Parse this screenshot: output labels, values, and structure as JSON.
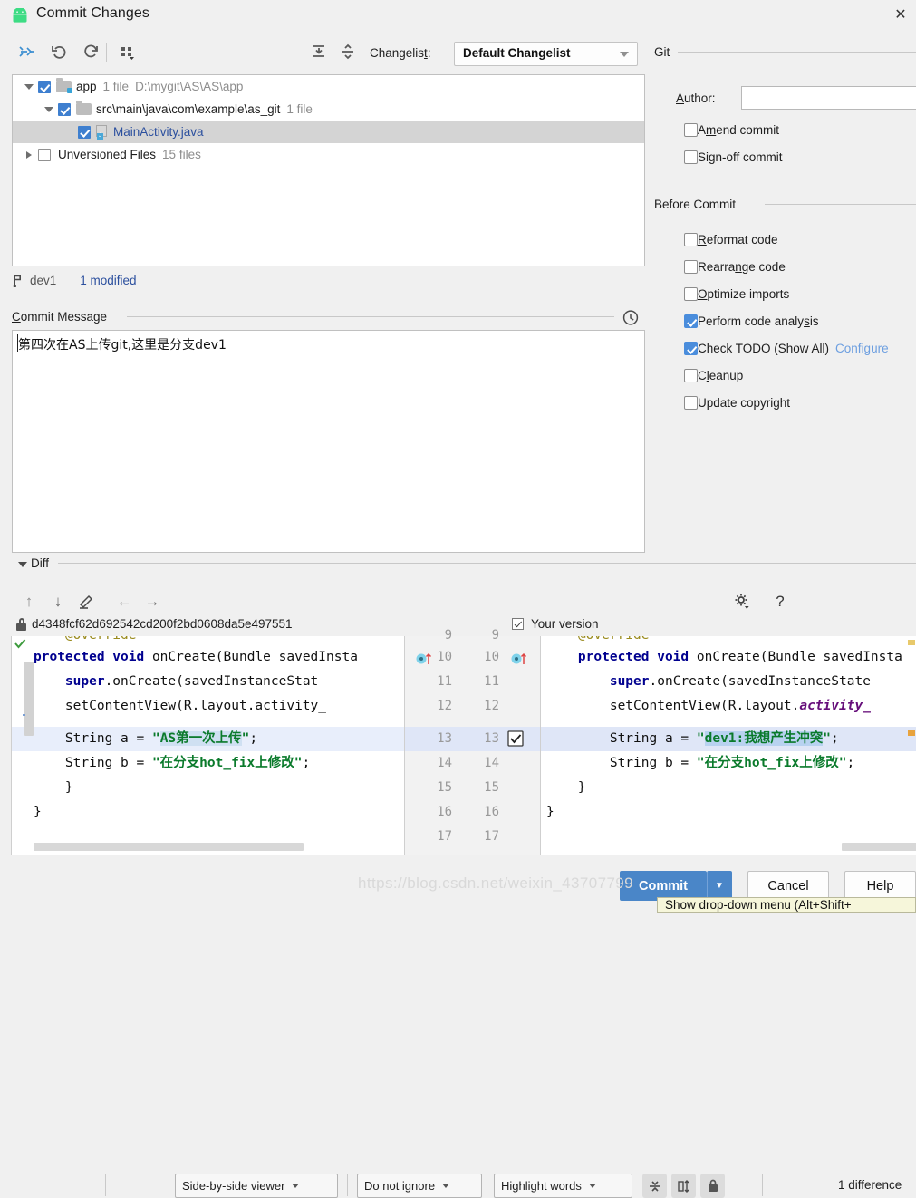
{
  "window": {
    "title": "Commit Changes",
    "icon": "android-robot-icon",
    "close_label": "✕"
  },
  "toolbar": {
    "buttons": [
      {
        "name": "collapse-arrows-icon",
        "glyph": "collapse"
      },
      {
        "name": "revert-icon",
        "glyph": "undo"
      },
      {
        "name": "refresh-icon",
        "glyph": "refresh"
      },
      {
        "name": "group-by-icon",
        "glyph": "group"
      },
      {
        "name": "expand-all-icon",
        "glyph": "expand-all"
      },
      {
        "name": "collapse-all-icon",
        "glyph": "collapse-all"
      }
    ],
    "changelist_label": "Changelist:",
    "changelist_value": "Default Changelist"
  },
  "tree": {
    "rows": [
      {
        "indent": 0,
        "twisty": "open",
        "checked": true,
        "icon": "folder-module-icon",
        "name": "app",
        "meta": "1 file",
        "meta2": "D:\\mygit\\AS\\AS\\app",
        "selected": false,
        "link": false
      },
      {
        "indent": 1,
        "twisty": "open",
        "checked": true,
        "icon": "folder-icon",
        "name": "src\\main\\java\\com\\example\\as_git",
        "meta": "1 file",
        "meta2": "",
        "selected": false,
        "link": false
      },
      {
        "indent": 2,
        "twisty": "none",
        "checked": true,
        "icon": "java-file-icon",
        "name": "MainActivity.java",
        "meta": "",
        "meta2": "",
        "selected": true,
        "link": true
      },
      {
        "indent": 0,
        "twisty": "closed",
        "checked": false,
        "icon": "none",
        "name": "Unversioned Files",
        "meta": "15 files",
        "meta2": "",
        "selected": false,
        "link": false
      }
    ]
  },
  "status": {
    "branch_icon": "git-branch-icon",
    "branch": "dev1",
    "modified": "1 modified"
  },
  "commit_message": {
    "section_title": "Commit Message",
    "section_mnemonic": "C",
    "history_icon": "clock-history-icon",
    "value": "第四次在AS上传git,这里是分支dev1",
    "placeholder": ""
  },
  "git_panel": {
    "section_title": "Git",
    "author_label": "Author:",
    "author_mnemonic": "A",
    "author_value": "",
    "checkboxes": [
      {
        "label": "Amend commit",
        "mnemonic": "m",
        "checked": false,
        "name": "amend-commit-checkbox"
      },
      {
        "label": "Sign-off commit",
        "mnemonic": "g",
        "checked": false,
        "name": "sign-off-commit-checkbox"
      }
    ]
  },
  "before_commit": {
    "section_title": "Before Commit",
    "checkboxes": [
      {
        "label": "Reformat code",
        "mnemonic": "R",
        "checked": false,
        "name": "reformat-code-checkbox",
        "link": ""
      },
      {
        "label": "Rearrange code",
        "mnemonic": "n",
        "checked": false,
        "name": "rearrange-code-checkbox",
        "link": ""
      },
      {
        "label": "Optimize imports",
        "mnemonic": "O",
        "checked": false,
        "name": "optimize-imports-checkbox",
        "link": ""
      },
      {
        "label": "Perform code analysis",
        "mnemonic": "s",
        "checked": true,
        "name": "perform-code-analysis-checkbox",
        "link": ""
      },
      {
        "label": "Check TODO (Show All)",
        "mnemonic": "",
        "checked": true,
        "name": "check-todo-checkbox",
        "link": "Configure"
      },
      {
        "label": "Cleanup",
        "mnemonic": "l",
        "checked": false,
        "name": "cleanup-checkbox",
        "link": ""
      },
      {
        "label": "Update copyright",
        "mnemonic": "",
        "checked": false,
        "name": "update-copyright-checkbox",
        "link": ""
      }
    ]
  },
  "diff": {
    "section_title": "Diff",
    "toolbar": {
      "prev_diff": "↑",
      "next_diff": "↓",
      "edit": "edit-pencil-icon",
      "left_arrow": "←",
      "right_arrow": "→",
      "viewer_mode": "Side-by-side viewer",
      "ignore_mode": "Do not ignore",
      "highlight_mode": "Highlight words",
      "collapse_unchanged": "collapse-unchanged-icon",
      "synchronize_scroll": "synchronize-scroll-icon",
      "read_only": "lock-icon",
      "settings": "gear-icon",
      "help": "?",
      "difference_count": "1 difference"
    },
    "left_header": {
      "lock_icon": "lock-icon",
      "revision": "d4348fcf62d692542cd200f2bd0608da5e497551"
    },
    "right_header": {
      "checked": true,
      "label": "Your version"
    },
    "left_code": [
      {
        "num": "",
        "segments": [
          {
            "t": "    @Override",
            "c": "ann"
          }
        ],
        "hl": false
      },
      {
        "num": "",
        "segments": [
          {
            "t": "    ",
            "c": "plain"
          },
          {
            "t": "protected void ",
            "c": "kw"
          },
          {
            "t": "onCreate(Bundle savedInsta",
            "c": "plain"
          }
        ],
        "hl": false
      },
      {
        "num": "",
        "segments": [
          {
            "t": "        ",
            "c": "plain"
          },
          {
            "t": "super",
            "c": "kw"
          },
          {
            "t": ".onCreate(savedInstanceStat",
            "c": "plain"
          }
        ],
        "hl": false
      },
      {
        "num": "",
        "segments": [
          {
            "t": "        setContentView(R.layout.activity_",
            "c": "plain"
          }
        ],
        "hl": false
      },
      {
        "num": "",
        "segments": [
          {
            "t": "        String a = ",
            "c": "plain"
          },
          {
            "t": "\"",
            "c": "str"
          },
          {
            "t": "AS第一次上传",
            "c": "sel"
          },
          {
            "t": "\"",
            "c": "str"
          },
          {
            "t": ";",
            "c": "plain"
          }
        ],
        "hl": true
      },
      {
        "num": "",
        "segments": [
          {
            "t": "        String b = ",
            "c": "plain"
          },
          {
            "t": "\"在分支hot_fix上修改\"",
            "c": "str"
          },
          {
            "t": ";",
            "c": "plain"
          }
        ],
        "hl": false
      },
      {
        "num": "",
        "segments": [
          {
            "t": "    }",
            "c": "plain"
          }
        ],
        "hl": false
      },
      {
        "num": "",
        "segments": [
          {
            "t": "}",
            "c": "plain"
          }
        ],
        "hl": false
      }
    ],
    "right_code": [
      {
        "num": "",
        "segments": [
          {
            "t": "    @Override",
            "c": "ann"
          }
        ],
        "hl": false
      },
      {
        "num": "10",
        "segments": [
          {
            "t": "    ",
            "c": "plain"
          },
          {
            "t": "protected void ",
            "c": "kw"
          },
          {
            "t": "onCreate(Bundle savedInsta",
            "c": "plain"
          }
        ],
        "hl": false
      },
      {
        "num": "11",
        "segments": [
          {
            "t": "        ",
            "c": "plain"
          },
          {
            "t": "super",
            "c": "kw"
          },
          {
            "t": ".onCreate(savedInstanceState",
            "c": "plain"
          }
        ],
        "hl": false
      },
      {
        "num": "12",
        "segments": [
          {
            "t": "        setContentView(R.layout.",
            "c": "plain"
          },
          {
            "t": "activity_",
            "c": "fld"
          }
        ],
        "hl": false
      },
      {
        "num": "13",
        "segments": [
          {
            "t": "        String a = ",
            "c": "plain"
          },
          {
            "t": "\"",
            "c": "str"
          },
          {
            "t": "dev1:我想产生冲突",
            "c": "sel"
          },
          {
            "t": "\"",
            "c": "str"
          },
          {
            "t": ";",
            "c": "plain"
          }
        ],
        "hl": true
      },
      {
        "num": "14",
        "segments": [
          {
            "t": "        String b = ",
            "c": "plain"
          },
          {
            "t": "\"在分支hot_fix上修改\"",
            "c": "str"
          },
          {
            "t": ";",
            "c": "plain"
          }
        ],
        "hl": false
      },
      {
        "num": "15",
        "segments": [
          {
            "t": "    }",
            "c": "plain"
          }
        ],
        "hl": false
      },
      {
        "num": "16",
        "segments": [
          {
            "t": "}",
            "c": "plain"
          }
        ],
        "hl": false
      },
      {
        "num": "17",
        "segments": [
          {
            "t": "",
            "c": "plain"
          }
        ],
        "hl": false
      }
    ],
    "gutter_left_numbers": [
      "9",
      "10",
      "11",
      "12",
      "13",
      "14",
      "15",
      "16",
      "17"
    ],
    "gutter_right_numbers": [
      "9",
      "10",
      "11",
      "12",
      "13",
      "14",
      "15",
      "16",
      "17"
    ]
  },
  "footer": {
    "commit_label": "Commit",
    "dropdown_glyph": "▼",
    "cancel_label": "Cancel",
    "help_label": "Help",
    "tooltip": "Show drop-down menu (Alt+Shift+",
    "watermark": "https://blog.csdn.net/weixin_43707799"
  },
  "colors": {
    "accent": "#4a86c8",
    "checkbox_on": "#4a8ddc",
    "link": "#2b4f9e",
    "string": "#0a7a2b",
    "keyword": "#00008f",
    "diff_highlight": "#dfe6f7"
  }
}
